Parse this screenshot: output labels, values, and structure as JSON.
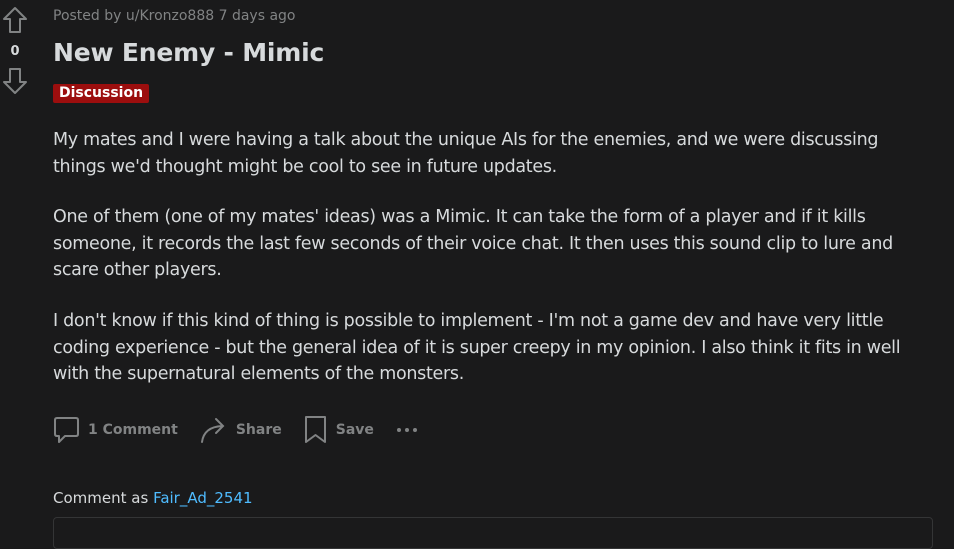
{
  "vote": {
    "score": "0",
    "up_icon": "arrow-up-outline-icon",
    "down_icon": "arrow-down-outline-icon"
  },
  "post": {
    "meta": "Posted by u/Kronzo888 7 days ago",
    "title": "New Enemy - Mimic",
    "flair": "Discussion",
    "flair_color": "#9c0e0e",
    "paragraphs": [
      {
        "lines": [
          "My mates and I were having a talk about the unique AIs for the enemies, and we were discussing",
          "things we'd thought might be cool to see in future updates."
        ]
      },
      {
        "lines": [
          "One of them (one of my mates' ideas) was a Mimic. It can take the form of a player and if it kills",
          "someone, it records the last few seconds of their voice chat. It then uses this sound clip to lure and",
          "scare other players."
        ]
      },
      {
        "lines": [
          "I don't know if this kind of thing is possible to implement - I'm not a game dev and have very little",
          "coding experience - but the general idea of it is super creepy in my opinion. I also think it fits in well",
          "with the supernatural elements of the monsters."
        ]
      }
    ]
  },
  "actions": {
    "comments": "1 Comment",
    "share": "Share",
    "save": "Save",
    "more_icon": "more-horizontal-icon"
  },
  "comment": {
    "prefix": "Comment as",
    "username": "Fair_Ad_2541",
    "username_color": "#4fbcff"
  }
}
